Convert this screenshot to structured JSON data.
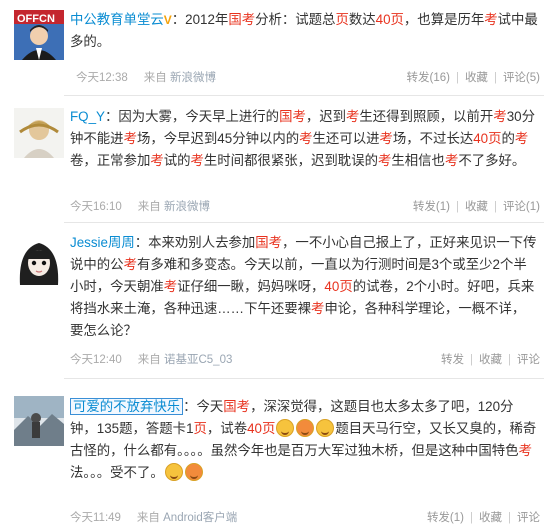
{
  "posts": [
    {
      "user": "中公教育单堂云",
      "badge": "V",
      "segments": [
        {
          "t": "：2012年",
          "h": false
        },
        {
          "t": "国考",
          "h": true
        },
        {
          "t": "分析：试题总",
          "h": false
        },
        {
          "t": "页",
          "h": true
        },
        {
          "t": "数达",
          "h": false
        },
        {
          "t": "40页",
          "h": true
        },
        {
          "t": "，也算是历年",
          "h": false
        },
        {
          "t": "考",
          "h": true
        },
        {
          "t": "试中最多的。",
          "h": false
        }
      ],
      "time": "今天12:38",
      "source_prefix": "来自",
      "source": "新浪微博",
      "repost": "转发(16)",
      "fav": "收藏",
      "comment": "评论(5)"
    },
    {
      "user": "FQ_Y",
      "segments": [
        {
          "t": "：因为大雾，今天早上进行的",
          "h": false
        },
        {
          "t": "国考",
          "h": true
        },
        {
          "t": "，迟到",
          "h": false
        },
        {
          "t": "考",
          "h": true
        },
        {
          "t": "生还得到照顾，以前开",
          "h": false
        },
        {
          "t": "考",
          "h": true
        },
        {
          "t": "30分钟不能进",
          "h": false
        },
        {
          "t": "考",
          "h": true
        },
        {
          "t": "场，今早迟到45分钟以内的",
          "h": false
        },
        {
          "t": "考",
          "h": true
        },
        {
          "t": "生还可以进",
          "h": false
        },
        {
          "t": "考",
          "h": true
        },
        {
          "t": "场，不过长达",
          "h": false
        },
        {
          "t": "40页",
          "h": true
        },
        {
          "t": "的",
          "h": false
        },
        {
          "t": "考",
          "h": true
        },
        {
          "t": "卷，正常参加",
          "h": false
        },
        {
          "t": "考",
          "h": true
        },
        {
          "t": "试的",
          "h": false
        },
        {
          "t": "考",
          "h": true
        },
        {
          "t": "生时间都很紧张，迟到耽误的",
          "h": false
        },
        {
          "t": "考",
          "h": true
        },
        {
          "t": "生相信也",
          "h": false
        },
        {
          "t": "考",
          "h": true
        },
        {
          "t": "不了多好。",
          "h": false
        }
      ],
      "time": "今天16:10",
      "source_prefix": "来自",
      "source": "新浪微博",
      "repost": "转发(1)",
      "fav": "收藏",
      "comment": "评论(1)"
    },
    {
      "user": "Jessie周周",
      "segments": [
        {
          "t": "：本来劝别人去参加",
          "h": false
        },
        {
          "t": "国考",
          "h": true
        },
        {
          "t": "，一不小心自己报上了，正好来见识一下传说中的公",
          "h": false
        },
        {
          "t": "考",
          "h": true
        },
        {
          "t": "有多难和多变态。今天以前，一直以为行测时间是3个或至少2个半小时，今天朝准",
          "h": false
        },
        {
          "t": "考",
          "h": true
        },
        {
          "t": "证仔细一瞅，妈妈咪呀，",
          "h": false
        },
        {
          "t": "40页",
          "h": true
        },
        {
          "t": "的试卷，2个小时。好吧，兵来将挡水来土淹，各种迅速……下午还要裸",
          "h": false
        },
        {
          "t": "考",
          "h": true
        },
        {
          "t": "申论，各种科学理论，一概不详，要怎么论？",
          "h": false
        }
      ],
      "time": "今天12:40",
      "source_prefix": "来自",
      "source": "诺基亚C5_03",
      "repost": "转发",
      "fav": "收藏",
      "comment": "评论"
    },
    {
      "user": "可爱的不放弃快乐",
      "segments": [
        {
          "t": "：今天",
          "h": false
        },
        {
          "t": "国考",
          "h": true
        },
        {
          "t": "，深深觉得，这题目也太多太多了吧，120分钟，135题，答题卡1",
          "h": false
        },
        {
          "t": "页",
          "h": true
        },
        {
          "t": "，试卷",
          "h": false
        },
        {
          "t": "40页",
          "h": true
        },
        {
          "t": "[emoji][emoji][emoji]",
          "h": false
        },
        {
          "t": "题目天马行空，又长又臭的，稀奇古怪的，什么都有。。。。虽然今年也是百万大军过独木桥，但是这种中国特色",
          "h": false
        },
        {
          "t": "考",
          "h": true
        },
        {
          "t": "法。。。受不了。",
          "h": false
        },
        {
          "t": "[emoji][emoji]",
          "h": false
        }
      ],
      "time": "今天11:49",
      "source_prefix": "来自",
      "source": "Android客户端",
      "repost": "转发(1)",
      "fav": "收藏",
      "comment": "评论"
    }
  ]
}
